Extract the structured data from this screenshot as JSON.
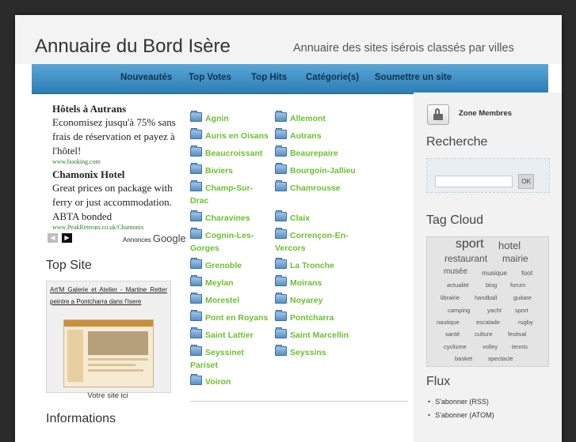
{
  "header": {
    "title": "Annuaire du Bord Isère",
    "subtitle": "Annuaire des sites isérois classés par villes"
  },
  "nav": [
    "Nouveautés",
    "Top Votes",
    "Top Hits",
    "Catégorie(s)",
    "Soumettre un site"
  ],
  "ads": [
    {
      "title": "Hôtels à Autrans",
      "text": "Economisez jusqu'à 75% sans frais de réservation et payez à l'hôtel!",
      "url": "www.booking.com"
    },
    {
      "title": "Chamonix Hotel",
      "text": "Great prices on package with ferry or just accommodation. ABTA bonded",
      "url": "www.PeakRetreats.co.uk/Chamonix"
    }
  ],
  "ads_footer": {
    "prefix": "Annonces",
    "brand": "Google"
  },
  "left": {
    "top_site_heading": "Top Site",
    "top_site_link": "Art'M Galerie et Atelier - Martine Retter peintre a Pontcharra dans l'Isere",
    "votre_site": "Votre site ici",
    "informations_heading": "Informations"
  },
  "cities_left": [
    "Agnin",
    "Auris en Oisans",
    "Beaucroissant",
    "Biviers",
    "Champ-Sur-Drac",
    "Charavines",
    "Cognin-Les-Gorges",
    "Grenoble",
    "Meylan",
    "Morestel",
    "Pont en Royans",
    "Saint Lattier",
    "Seyssinet Pariset",
    "Voiron"
  ],
  "cities_right": [
    "Allemont",
    "Autrans",
    "Beaurepaire",
    "Bourgoin-Jallieu",
    "Chamrousse",
    "Claix",
    "Corrençon-En-Vercors",
    "La Tronche",
    "Moirans",
    "Noyarey",
    "Pontcharra",
    "Saint Marcellin",
    "Seyssins"
  ],
  "right": {
    "zone_membres": "Zone Membres",
    "recherche_heading": "Recherche",
    "ok_label": "OK",
    "tag_cloud_heading": "Tag Cloud",
    "tags": [
      "sport",
      "hotel",
      "restaurant",
      "mairie",
      "musée",
      "musique",
      "foot",
      "actualité",
      "blog",
      "forum",
      "librairie",
      "handball",
      "guitare",
      "camping",
      "yacht",
      "sport",
      "nautique",
      "escalade",
      "rugby",
      "santé",
      "culture",
      "festival",
      "cyclisme",
      "volley",
      "tennis",
      "basket",
      "spectacle"
    ],
    "flux_heading": "Flux",
    "flux_items": [
      "S'abonner (RSS)",
      "S'abonner (ATOM)"
    ]
  },
  "colors": {
    "nav_gradient_top": "#5aa7d6",
    "nav_gradient_bottom": "#2c7cb5",
    "city_link": "#6cbf2d",
    "ad_url": "#2a7a2a"
  }
}
